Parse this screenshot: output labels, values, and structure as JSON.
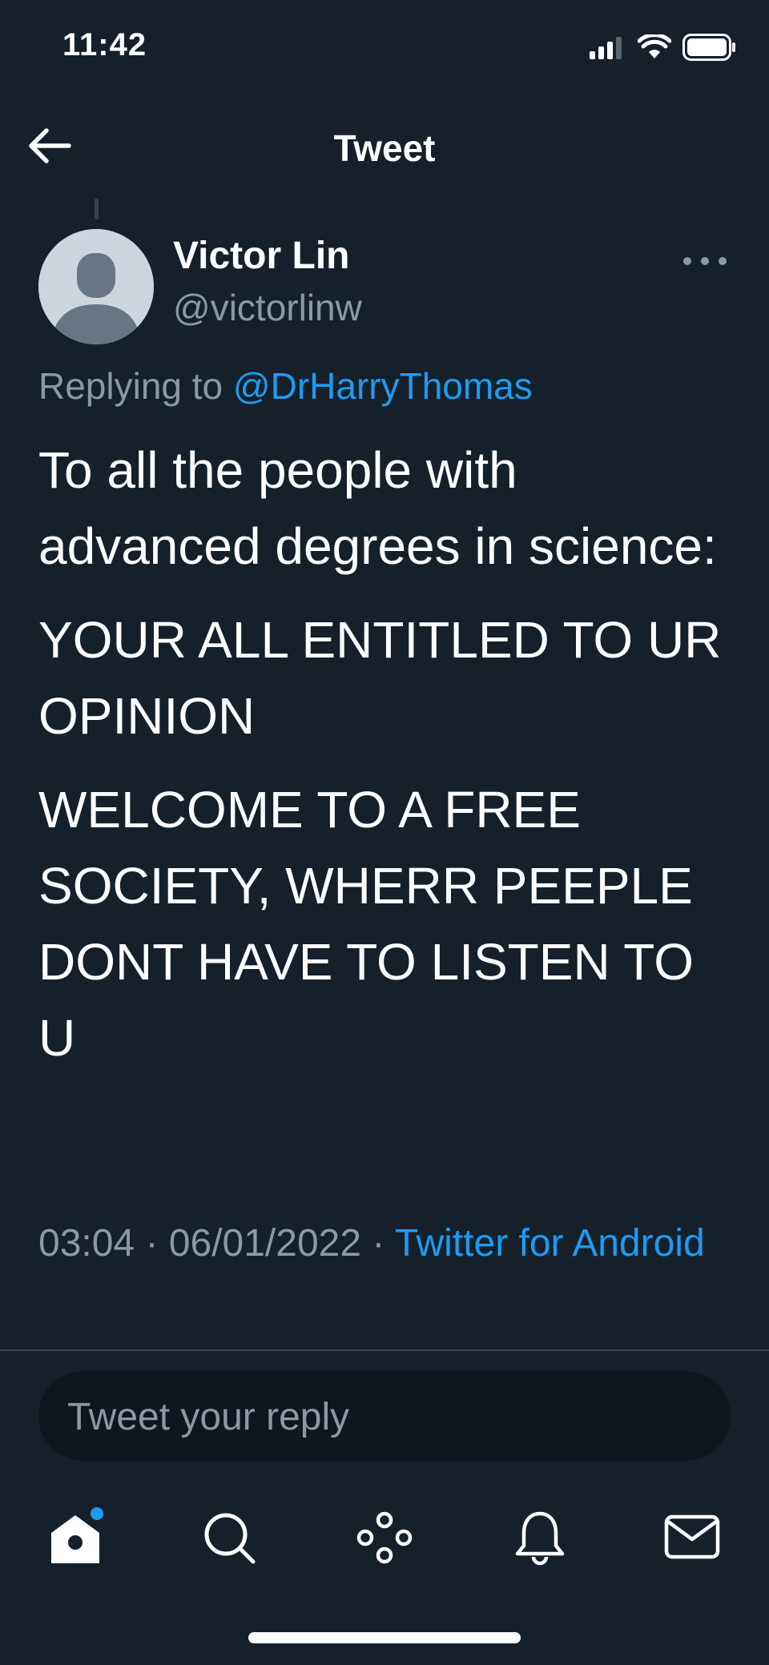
{
  "status_bar": {
    "time": "11:42"
  },
  "header": {
    "title": "Tweet"
  },
  "tweet": {
    "author_name": "Victor Lin",
    "author_handle": "@victorlinw",
    "replying_prefix": "Replying to",
    "replying_to": "@DrHarryThomas",
    "paragraphs": [
      "To all the people with advanced degrees in science:",
      "YOUR ALL ENTITLED TO UR OPINION",
      "WELCOME TO A FREE SOCIETY, WHERR PEEPLE DONT HAVE TO LISTEN TO U"
    ],
    "time": "03:04",
    "date": "06/01/2022",
    "separator": "·",
    "source": "Twitter for Android"
  },
  "reply": {
    "placeholder": "Tweet your reply"
  },
  "tabs": [
    {
      "icon": "home-icon",
      "label": "Home"
    },
    {
      "icon": "search-icon",
      "label": "Search"
    },
    {
      "icon": "spaces-icon",
      "label": "Spaces"
    },
    {
      "icon": "bell-icon",
      "label": "Notifications"
    },
    {
      "icon": "mail-icon",
      "label": "Messages"
    }
  ],
  "colors": {
    "background": "#15202b",
    "accent": "#1d9bf0",
    "secondary_text": "#8b98a5",
    "reply_box": "#0f161e"
  }
}
